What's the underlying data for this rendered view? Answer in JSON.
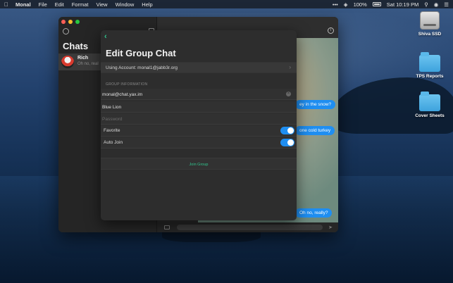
{
  "menubar": {
    "app_name": "Monal",
    "items": [
      "File",
      "Edit",
      "Format",
      "View",
      "Window",
      "Help"
    ],
    "battery": "100%",
    "clock": "Sat 10:19 PM"
  },
  "desktop_icons": [
    {
      "label": "Shiva SSD",
      "type": "drive"
    },
    {
      "label": "TPS Reports",
      "type": "folder"
    },
    {
      "label": "Cover Sheets",
      "type": "folder"
    }
  ],
  "sidebar": {
    "title": "Chats",
    "chats": [
      {
        "name": "Rich",
        "preview": "Oh no, real"
      }
    ]
  },
  "conversation": {
    "bubbles": [
      {
        "text": "ey in the snow?"
      },
      {
        "text": "one cold turkey"
      },
      {
        "text": "Oh no, really?"
      }
    ]
  },
  "sheet": {
    "title": "Edit Group Chat",
    "account_label": "Using Account: monal1@jabb3r.org",
    "section_header": "GROUP INFORMATION",
    "room_value": "monal@chat.yax.im",
    "name_value": "Blue Lion",
    "password_placeholder": "Password",
    "favorite_label": "Favorite",
    "favorite_on": true,
    "autojoin_label": "Auto Join",
    "autojoin_on": true,
    "join_label": "Join Group"
  },
  "colors": {
    "accent_green": "#31c48d",
    "switch_blue": "#1f8ef1",
    "bubble_blue": "#1f8ef1"
  }
}
